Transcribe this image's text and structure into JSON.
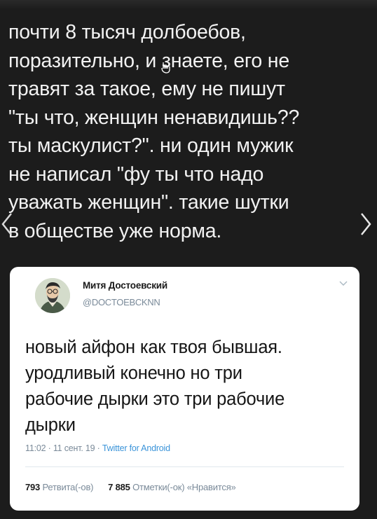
{
  "post": {
    "lines": [
      "почти 8 тысяч долбоебов,",
      "поразительно, и знаете, его не",
      "травят за такое, ему не пишут",
      "\"ты что, женщин ненавидишь??",
      "ты маскулист?\". ни один мужик",
      "не написал \"фу ты что надо",
      "уважать женщин\". такие шутки",
      "в обществе уже норма."
    ]
  },
  "tweet": {
    "author_name": "Митя Достоевский",
    "author_handle": "@DOCTOEBCKNN",
    "body_lines": [
      "новый айфон как твоя бывшая.",
      "уродливый конечно но три",
      "рабочие дырки это три рабочие",
      "дырки"
    ],
    "time": "11:02 · 11 сент. 19 · ",
    "source": "Twitter for Android",
    "retweets_count": "793",
    "retweets_label": "Ретвита(-ов)",
    "likes_count": "7 885",
    "likes_label": "Отметки(-ок) «Нравится»"
  },
  "colors": {
    "background": "#1c1c1c",
    "post_text": "#f2f2f2",
    "card": "#ffffff",
    "muted": "#7a8a99",
    "link": "#3b94d9"
  },
  "icons": [
    "arrow-left-icon",
    "arrow-right-icon",
    "chevron-down-icon",
    "cursor-icon"
  ]
}
